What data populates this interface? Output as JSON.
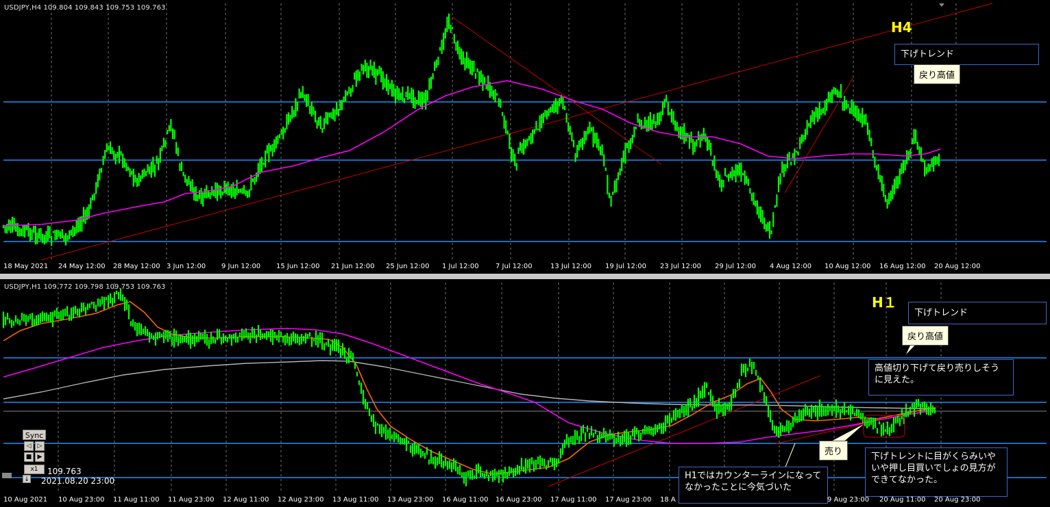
{
  "top_pane": {
    "header": "USDJPY,H4  109.804 109.843 109.753 109.763",
    "label": "H4",
    "trend_box": "下げトレンド",
    "callout": "戻り高値",
    "x_labels": [
      "18 May 2021",
      "24 May 12:00",
      "28 May 12:00",
      "3 Jun 12:00",
      "9 Jun 12:00",
      "15 Jun 12:00",
      "21 Jun 12:00",
      "25 Jun 12:00",
      "1 Jul 12:00",
      "7 Jul 12:00",
      "13 Jul 12:00",
      "19 Jul 12:00",
      "23 Jul 12:00",
      "29 Jul 12:00",
      "4 Aug 12:00",
      "10 Aug 12:00",
      "16 Aug 12:00",
      "20 Aug 12:00"
    ]
  },
  "bottom_pane": {
    "header": "USDJPY,H1  109.772 109.798 109.753 109.763",
    "label": "H１",
    "trend_box": "下げトレンド",
    "callout_high": "戻り高値",
    "note_sell_view": "高値切り下げて戻り売りしそうに見えた。",
    "callout_sell": "売り",
    "note_counter": "H1ではカウンターラインになってなかったことに今気づいた",
    "note_buy": "下げトレントに目がくらみいやいや押し目買いでしょの見方ができてなかった。",
    "x_labels": [
      "10 Aug 2021",
      "10 Aug 23:00",
      "11 Aug 11:00",
      "11 Aug 23:00",
      "12 Aug 11:00",
      "12 Aug 23:00",
      "13 Aug 11:00",
      "13 Aug 23:00",
      "16 Aug 11:00",
      "16 Aug 23:00",
      "17 Aug 11:00",
      "17 Aug 23:00",
      "18 A",
      "9 Aug 23:00",
      "20 Aug 11:00",
      "20 Aug 23:00"
    ],
    "sync": {
      "label": "Sync",
      "speed": "x1",
      "price": "109.763",
      "datetime": "2021.08.20 23:00"
    }
  },
  "colors": {
    "candle": "#00ff00",
    "ma_magenta": "#ff00ff",
    "ma_orange": "#ff6600",
    "ma_gray": "#b4b4b4",
    "hline": "#1e90ff",
    "trendline": "#cc0000",
    "label_yellow": "#ffff00"
  }
}
